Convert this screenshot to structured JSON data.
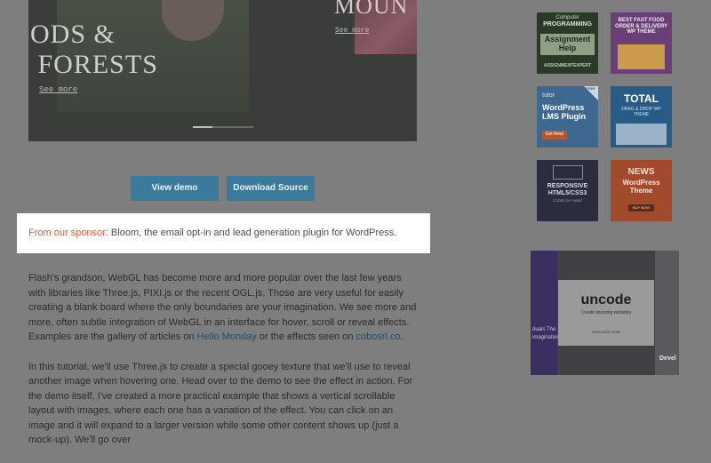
{
  "hero": {
    "title_left": "ODS &\n FORESTS",
    "see_more_left": "See more",
    "title_right": "MOUN",
    "see_more_right": "See more"
  },
  "buttons": {
    "view_demo": "View demo",
    "download_source": "Download Source"
  },
  "sponsor": {
    "label": "From our sponsor:",
    "text": " Bloom, the email opt-in and lead generation plugin for WordPress."
  },
  "article": {
    "p1_a": "Flash's grandson, WebGL has become more and more popular over the last few years with libraries like Three.js, PIXI.js or the recent OGL.js. Those are very useful for easily creating a blank board where the only boundaries are your imagination. We see more and more, often subtle integration of WebGL in an interface for hover, scroll or reveal effects. Examples are the gallery of articles on ",
    "link1": "Hello Monday",
    "p1_b": " or the effects seen on ",
    "link2": "cobosrl.co",
    "p1_c": ".",
    "p2": "In this tutorial, we'll use Three.js to create a special gooey texture that we'll use to reveal another image when hovering one. Head over to the demo to see the effect in action. For the demo itself, I've created a more practical example that shows a vertical scrollable layout with images, where each one has a variation of the effect. You can click on an image and it will expand to a larger version while some other content shows up (just a mock-up). We'll go over"
  },
  "ads": {
    "ad1": {
      "top": "Computer",
      "mid": "PROGRAMMING",
      "title": "Assignment Help",
      "bottom": "ASSIGNMENTEXPERT"
    },
    "ad2": {
      "title": "BEST FAST FOOD ORDER & DELIVERY WP THEME"
    },
    "ad3": {
      "brand": "tutor",
      "title": "WordPress LMS Plugin",
      "cta": "Get Now!",
      "badge": "FREE"
    },
    "ad4": {
      "title": "TOTAL",
      "sub": "DRAG & DROP WP THEME"
    },
    "ad5": {
      "title": "RESPONSIVE HTML5/CSS3",
      "sub": "CODED BY HAND"
    },
    "ad6": {
      "title": "NEWS",
      "sub": "WordPress Theme",
      "cta": "BUY NOW"
    },
    "uncode": {
      "title": "uncode",
      "sub": "Create stunning websites",
      "cta": "DISCOVER NOW",
      "left_a": "duals The",
      "left_b": "imagination",
      "right_a": "Devel"
    }
  }
}
